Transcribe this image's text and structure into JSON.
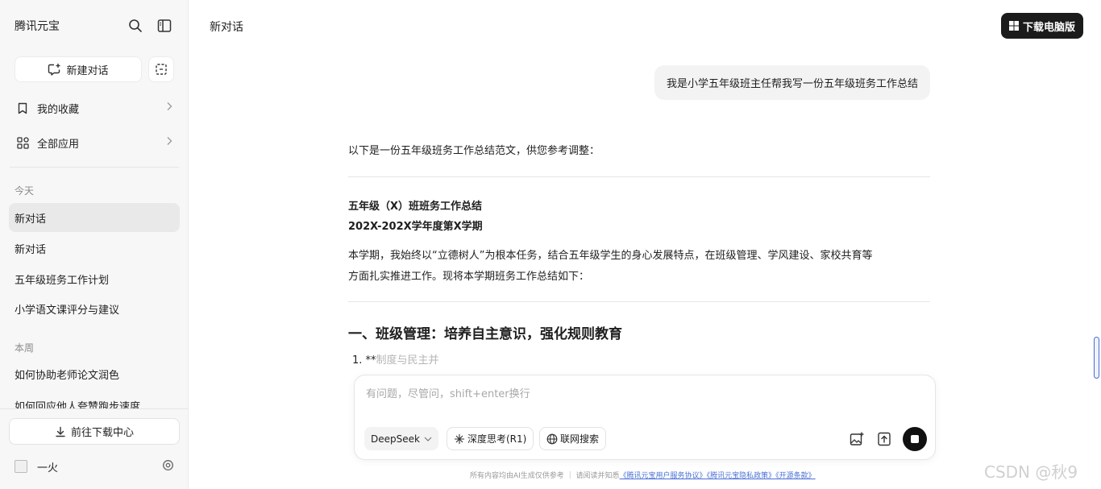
{
  "sidebar": {
    "brand": "腾讯元宝",
    "new_chat_label": "新建对话",
    "favorites_label": "我的收藏",
    "all_apps_label": "全部应用",
    "section_today": "今天",
    "section_week": "本周",
    "history_today": [
      "新对话",
      "新对话",
      "五年级班务工作计划",
      "小学语文课评分与建议"
    ],
    "history_week": [
      "如何协助老师论文润色",
      "如何回应他人夸赞跑步速度"
    ],
    "download_center_label": "前往下载中心",
    "username": "一火"
  },
  "main": {
    "title": "新对话",
    "download_pc_label": "下载电脑版"
  },
  "chat": {
    "user_message": "我是小学五年级班主任帮我写一份五年级班务工作总结",
    "answer": {
      "intro": "以下是一份五年级班务工作总结范文，供您参考调整：",
      "doc_title": "五年级（X）班班务工作总结",
      "doc_subtitle": "202X-202X学年度第X学期",
      "para_line1": "本学期，我始终以“立德树人”为根本任务，结合五年级学生的身心发展特点，在班级管理、学风建设、家校共育等",
      "para_line2": "方面扎实推进工作。现将本学期班务工作总结如下：",
      "section1": "一、班级管理：培养自主意识，强化规则教育",
      "list1_prefix": "1. **",
      "list1_faded": "制度与民主并"
    }
  },
  "input": {
    "placeholder": "有问题，尽管问，shift+enter换行",
    "model_label": "DeepSeek",
    "deep_think_label": "深度思考(R1)",
    "web_search_label": "联网搜索"
  },
  "footer": {
    "text": "所有内容均由AI生成仅供参考 ｜ 请阅读并知悉",
    "link1": "《腾讯元宝用户服务协议》",
    "link2": "《腾讯元宝隐私政策》",
    "link3": "《开源条款》"
  },
  "watermark": "CSDN @秋9",
  "colors": {
    "accent": "#4a6fd6",
    "dark_button": "#1b1b1b",
    "active_item": "#e9e9ea"
  }
}
